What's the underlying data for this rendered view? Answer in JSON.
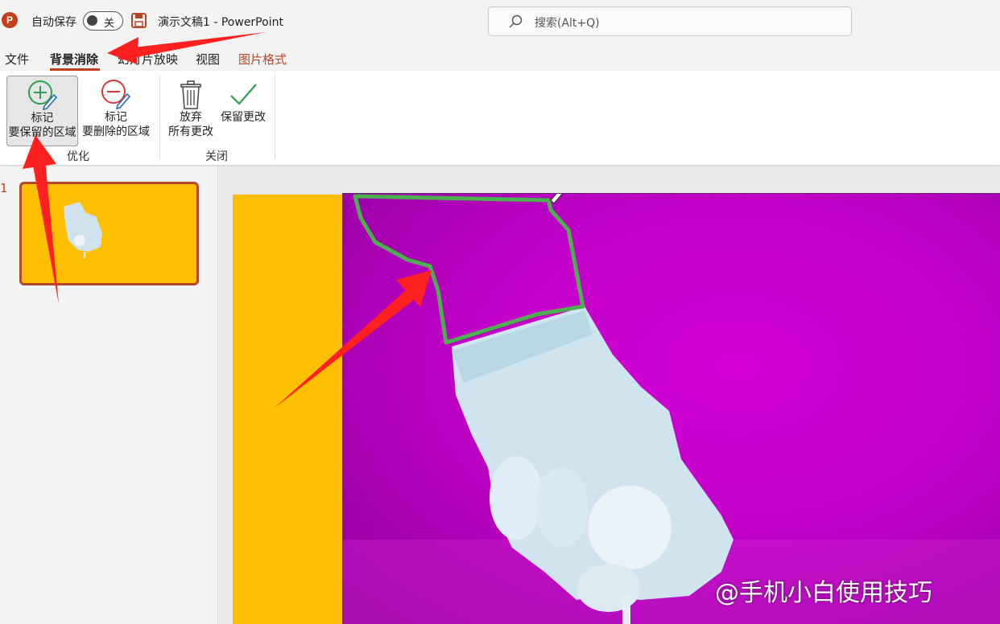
{
  "titlebar": {
    "app_icon_letter": "P",
    "autosave_label": "自动保存",
    "autosave_state": "关",
    "document_title": "演示文稿1  -  PowerPoint",
    "search_placeholder": "搜索(Alt+Q)"
  },
  "menubar": {
    "items": [
      "文件",
      "背景消除",
      "幻灯片放映",
      "视图",
      "图片格式"
    ],
    "active": "背景消除"
  },
  "ribbon": {
    "mark_keep": {
      "line1": "标记",
      "line2": "要保留的区域"
    },
    "mark_remove": {
      "line1": "标记",
      "line2": "要删除的区域"
    },
    "discard": {
      "line1": "放弃",
      "line2": "所有更改"
    },
    "keep_changes": "保留更改",
    "group_refine": "优化",
    "group_close": "关闭"
  },
  "thumbnails": {
    "slide_number": "1"
  },
  "watermark": "@手机小白使用技巧",
  "colors": {
    "accent": "#c43e1c",
    "slide_background": "#fdbf00",
    "removal_overlay": "#c200c8",
    "keep_stroke": "#4caf50",
    "annotation_arrow": "#ff2020"
  }
}
